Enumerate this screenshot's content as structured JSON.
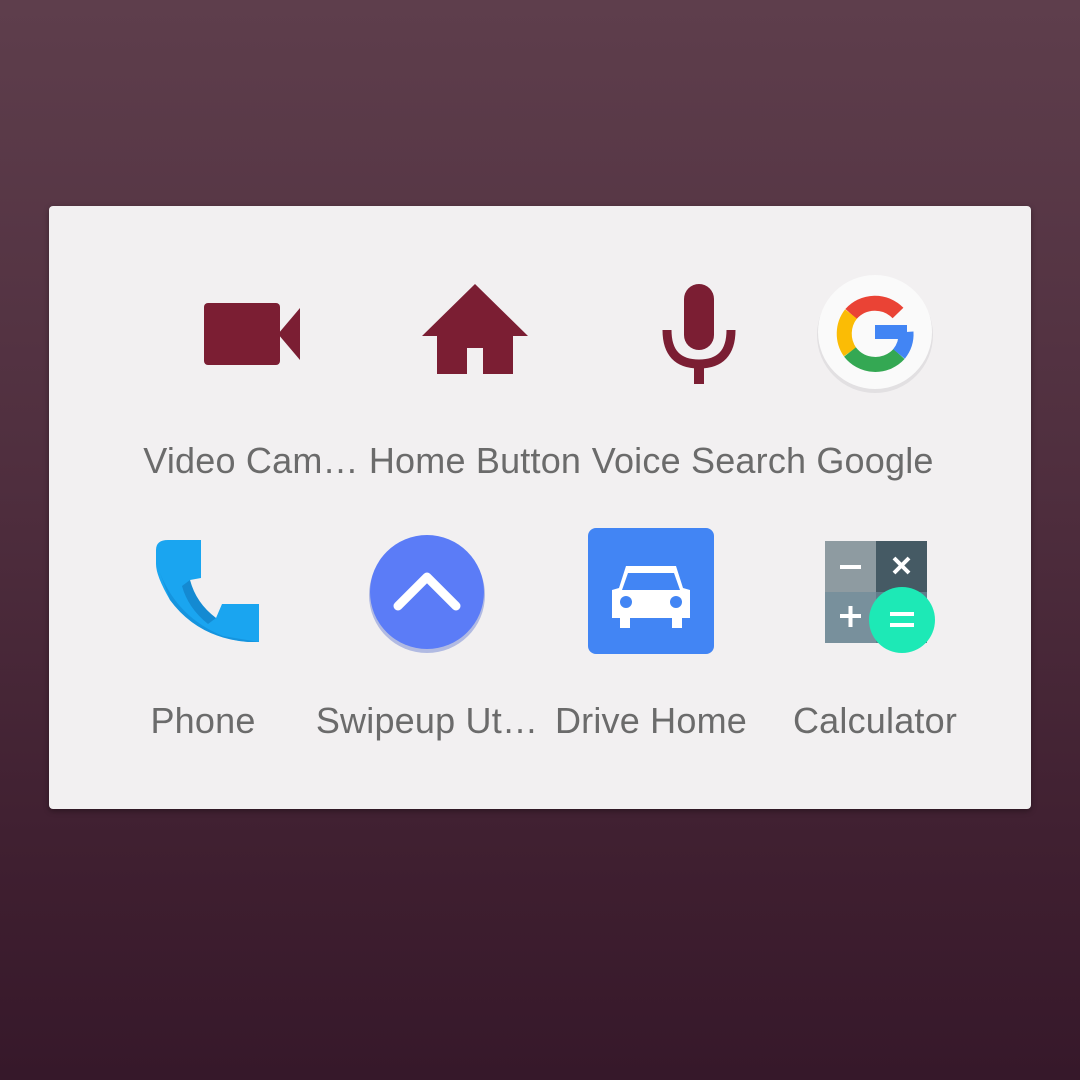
{
  "folder": {
    "apps": [
      {
        "label": "Video Cam…",
        "icon": "video-camera-icon"
      },
      {
        "label": "Home Button",
        "icon": "home-icon"
      },
      {
        "label": "Voice Search",
        "icon": "microphone-icon"
      },
      {
        "label": "Google",
        "icon": "google-icon"
      },
      {
        "label": "Phone",
        "icon": "phone-icon"
      },
      {
        "label": "Swipeup Ut…",
        "icon": "swipe-up-icon"
      },
      {
        "label": "Drive Home",
        "icon": "car-icon"
      },
      {
        "label": "Calculator",
        "icon": "calculator-icon"
      }
    ]
  },
  "colors": {
    "maroon": "#7b1e33",
    "panel": "#f2f0f1",
    "label": "#6b6b6b",
    "blue": "#4285f4",
    "swipe_blue": "#5b7cf7",
    "phone_blue": "#1aa5f0",
    "calc_teal": "#1de9b6"
  }
}
